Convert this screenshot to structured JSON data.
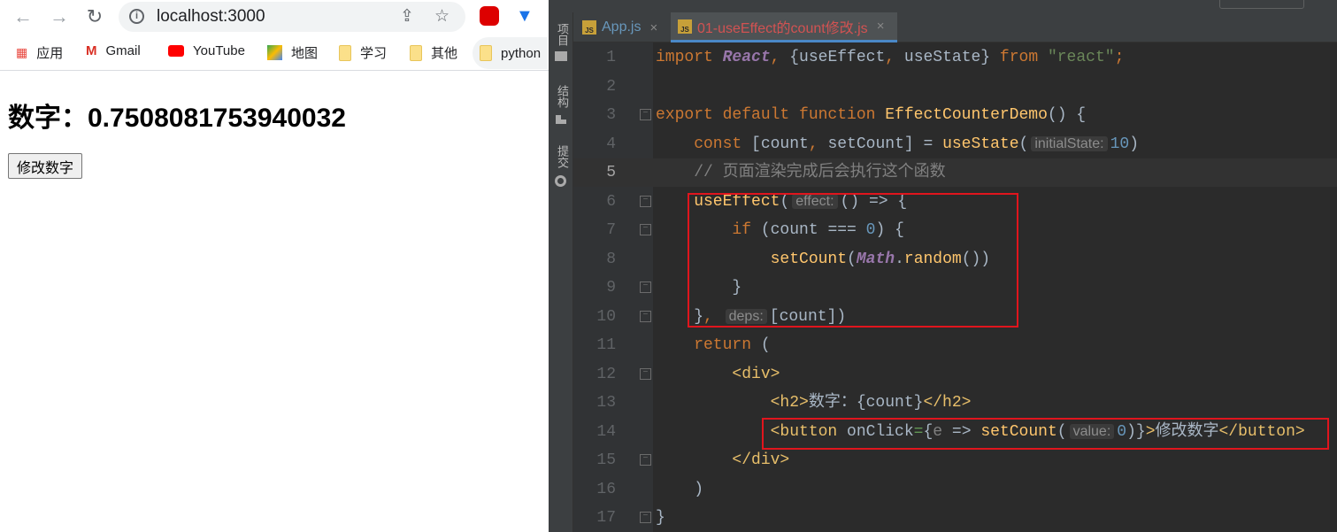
{
  "browser": {
    "url": "localhost:3000",
    "bookmarks": [
      {
        "label": "应用",
        "icon": "apps-grid-icon"
      },
      {
        "label": "Gmail",
        "icon": "gmail-icon"
      },
      {
        "label": "YouTube",
        "icon": "youtube-icon"
      },
      {
        "label": "地图",
        "icon": "maps-icon"
      },
      {
        "label": "学习",
        "icon": "folder-icon"
      },
      {
        "label": "其他",
        "icon": "folder-icon"
      },
      {
        "label": "python",
        "icon": "folder-icon"
      }
    ],
    "page": {
      "heading": "数字：0.7508081753940032",
      "button": "修改数字"
    }
  },
  "ide": {
    "side_tools": [
      "项目",
      "结构",
      "提交"
    ],
    "tabs": [
      {
        "label": "App.js",
        "active": false
      },
      {
        "label": "01-useEffect的count修改.js",
        "active": true
      }
    ],
    "colors": {
      "active_tab_text": "#d25252",
      "highlight_box": "#e0151d",
      "accent": "#4a88c7"
    },
    "current_line": 5,
    "lines": [
      {
        "n": "1",
        "t": [
          [
            "kw",
            "import "
          ],
          [
            "cls",
            "React"
          ],
          [
            "kw",
            ", "
          ],
          [
            "id",
            "{useEffect"
          ],
          [
            "kw",
            ", "
          ],
          [
            "id",
            "useState} "
          ],
          [
            "kw",
            "from "
          ],
          [
            "str",
            "\"react\""
          ],
          [
            "kw",
            ";"
          ]
        ]
      },
      {
        "n": "2",
        "t": []
      },
      {
        "n": "3",
        "fold": "open",
        "t": [
          [
            "kw",
            "export default function "
          ],
          [
            "fn",
            "EffectCounterDemo"
          ],
          [
            "id",
            "() {"
          ]
        ]
      },
      {
        "n": "4",
        "t": [
          [
            "kw",
            "    const "
          ],
          [
            "id",
            "[count"
          ],
          [
            "kw",
            ", "
          ],
          [
            "id",
            "setCount] = "
          ],
          [
            "fn",
            "useState"
          ],
          [
            "id",
            "("
          ],
          [
            "hint",
            "initialState:"
          ],
          [
            "num",
            "10"
          ],
          [
            "id",
            ")"
          ]
        ]
      },
      {
        "n": "5",
        "t": [
          [
            "cm",
            "    // 页面渲染完成后会执行这个函数"
          ]
        ]
      },
      {
        "n": "6",
        "fold": "open",
        "t": [
          [
            "fn",
            "    useEffect"
          ],
          [
            "id",
            "("
          ],
          [
            "hint",
            "effect:"
          ],
          [
            "id",
            "() => {"
          ]
        ]
      },
      {
        "n": "7",
        "fold": "open",
        "t": [
          [
            "kw",
            "        if "
          ],
          [
            "id",
            "(count === "
          ],
          [
            "num",
            "0"
          ],
          [
            "id",
            ") {"
          ]
        ]
      },
      {
        "n": "8",
        "t": [
          [
            "fn",
            "            setCount"
          ],
          [
            "id",
            "("
          ],
          [
            "cls",
            "Math"
          ],
          [
            "id",
            "."
          ],
          [
            "fn",
            "random"
          ],
          [
            "id",
            "())"
          ]
        ]
      },
      {
        "n": "9",
        "fold": "close",
        "t": [
          [
            "id",
            "        }"
          ]
        ]
      },
      {
        "n": "10",
        "fold": "close",
        "t": [
          [
            "id",
            "    }"
          ],
          [
            "kw",
            ", "
          ],
          [
            "hint",
            "deps:"
          ],
          [
            "id",
            "[count])"
          ]
        ]
      },
      {
        "n": "11",
        "t": [
          [
            "kw",
            "    return "
          ],
          [
            "id",
            "("
          ]
        ]
      },
      {
        "n": "12",
        "fold": "open",
        "t": [
          [
            "tag",
            "        <div>"
          ]
        ]
      },
      {
        "n": "13",
        "t": [
          [
            "tag",
            "            <h2>"
          ],
          [
            "id",
            "数字："
          ],
          [
            "id",
            "{count}"
          ],
          [
            "tag",
            "</h2>"
          ]
        ]
      },
      {
        "n": "14",
        "t": [
          [
            "tag",
            "            <button "
          ],
          [
            "id",
            "onClick"
          ],
          [
            "eq",
            "="
          ],
          [
            "id",
            "{"
          ],
          [
            "par",
            "e"
          ],
          [
            "id",
            " => "
          ],
          [
            "fn",
            "setCount"
          ],
          [
            "id",
            "("
          ],
          [
            "hint",
            "value:"
          ],
          [
            "num",
            "0"
          ],
          [
            "id",
            ")}"
          ],
          [
            "tag",
            ">"
          ],
          [
            "id",
            "修改数字"
          ],
          [
            "tag",
            "</button>"
          ]
        ]
      },
      {
        "n": "15",
        "fold": "close",
        "t": [
          [
            "tag",
            "        </div>"
          ]
        ]
      },
      {
        "n": "16",
        "t": [
          [
            "id",
            "    )"
          ]
        ]
      },
      {
        "n": "17",
        "fold": "close",
        "t": [
          [
            "id",
            "}"
          ]
        ]
      }
    ]
  }
}
